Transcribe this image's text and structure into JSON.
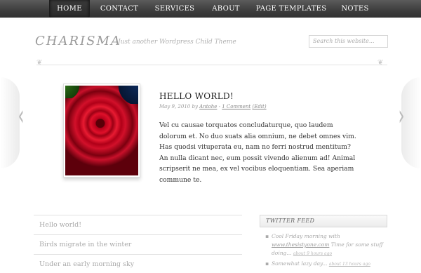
{
  "nav": {
    "items": [
      {
        "label": "HOME",
        "active": true
      },
      {
        "label": "CONTACT"
      },
      {
        "label": "SERVICES"
      },
      {
        "label": "ABOUT"
      },
      {
        "label": "PAGE TEMPLATES"
      },
      {
        "label": "NOTES"
      }
    ]
  },
  "header": {
    "logo": "CHARISMA",
    "tagline": "Just another Wordpress Child Theme",
    "search_placeholder": "Search this website..."
  },
  "slider": {
    "prev_icon": "‹",
    "next_icon": "›",
    "post": {
      "title": "HELLO WORLD!",
      "date": "May 9, 2010",
      "by": "by",
      "author": "Antohe",
      "comments": "1 Comment",
      "edit": "(Edit)",
      "excerpt": "Vel cu causae torquatos concludaturque, quo laudem dolorum et. No duo suats alia omnium, ne debet omnes vim. Has quodsi vituperata eu, nam no ferri nostrud mentitum? An nulla dicant nec, eum possit vivendo alienum ad! Animal scripserit ne mea, ex vel vocibus eloquentiam. Sea aperiam commune te."
    }
  },
  "recent_posts": {
    "items": [
      "Hello world!",
      "Birds migrate in the winter",
      "Under an early morning sky"
    ]
  },
  "twitter": {
    "title": "TWITTER FEED",
    "tweets": [
      {
        "pre": "Cool Friday morning with ",
        "link": "www.thesistyone.com",
        "post": " Time for some stuff doing...",
        "ago": "about 9 hours ago"
      },
      {
        "pre": "Somewhat lazy day...",
        "link": "",
        "post": "",
        "ago": "about 13 hours ago"
      }
    ]
  }
}
